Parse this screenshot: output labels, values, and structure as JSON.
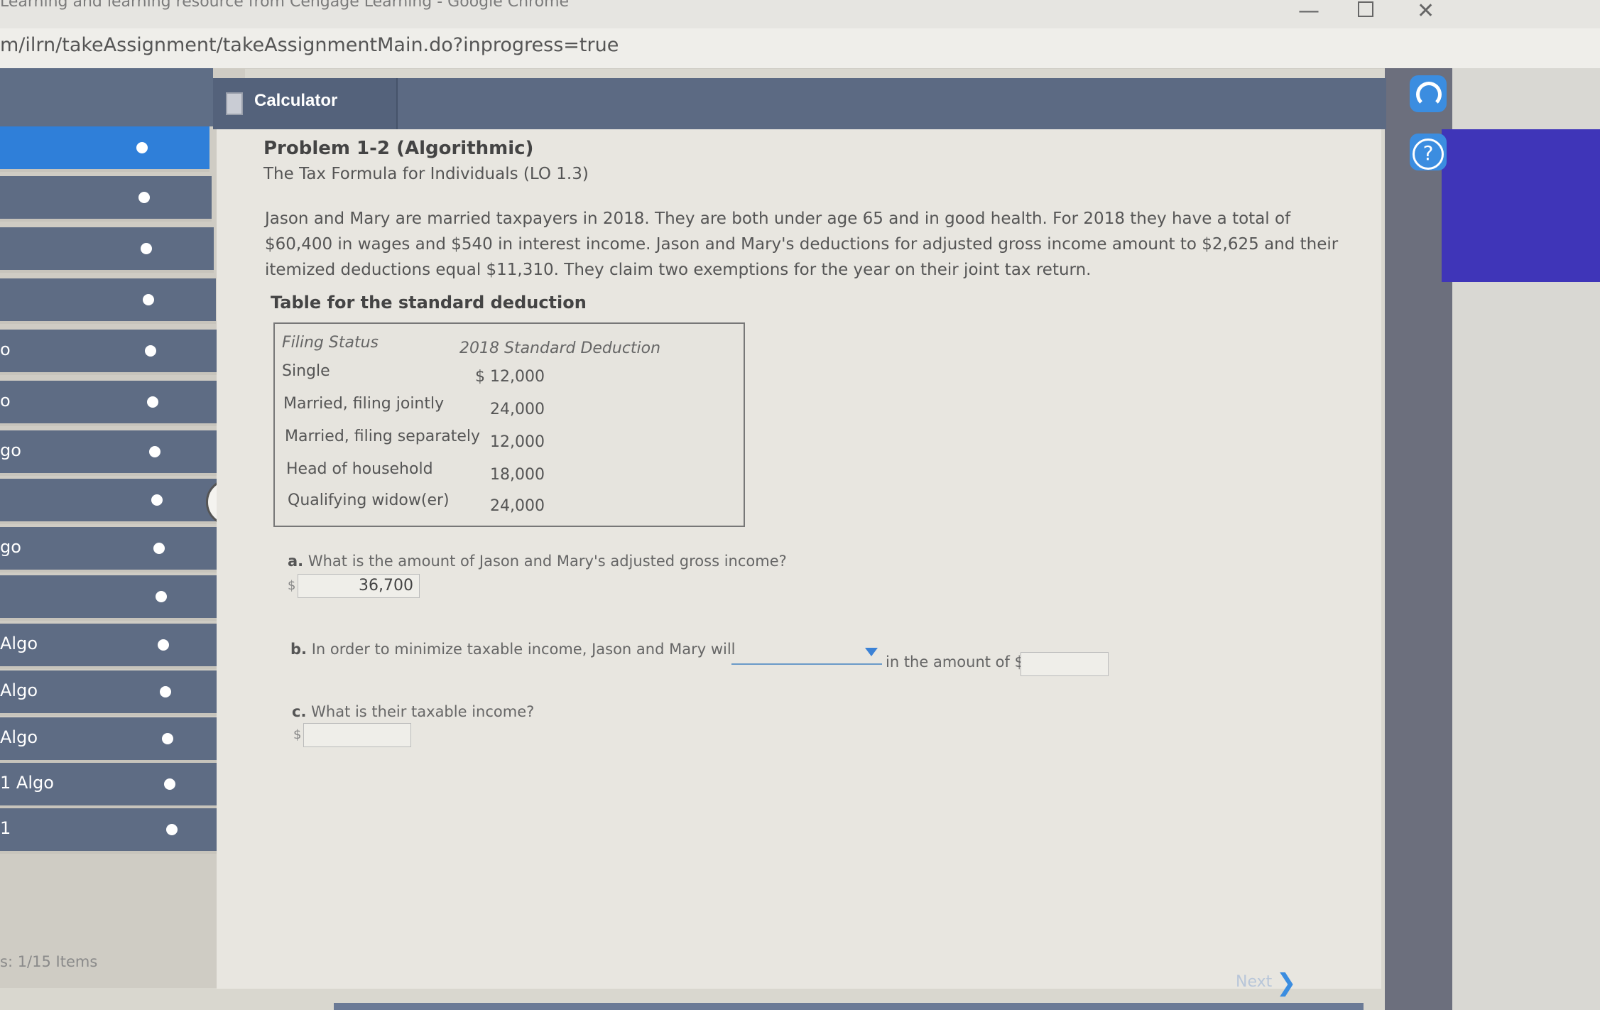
{
  "window": {
    "title": "Learning and learning resource from Cengage Learning - Google Chrome",
    "min_symbol": "—",
    "close_symbol": "✕",
    "url": "m/ilrn/takeAssignment/takeAssignmentMain.do?inprogress=true"
  },
  "toolbar": {
    "calculator_label": "Calculator"
  },
  "sidebar": {
    "items": [
      {
        "label": ""
      },
      {
        "label": ""
      },
      {
        "label": ""
      },
      {
        "label": ""
      },
      {
        "label": "o"
      },
      {
        "label": "o"
      },
      {
        "label": "go"
      },
      {
        "label": ""
      },
      {
        "label": "go"
      },
      {
        "label": ""
      },
      {
        "label": "Algo"
      },
      {
        "label": "Algo"
      },
      {
        "label": "Algo"
      },
      {
        "label": "1 Algo"
      },
      {
        "label": "1"
      }
    ],
    "footer": "s: 1/15 Items",
    "collapse_symbol": "<"
  },
  "problem": {
    "title": "Problem 1-2 (Algorithmic)",
    "subtitle": "The Tax Formula for Individuals (LO 1.3)",
    "text": "Jason and Mary are married taxpayers in 2018. They are both under age 65 and in good health. For 2018 they have a total of $60,400 in wages and $540 in interest income. Jason and Mary's deductions for adjusted gross income amount to $2,625 and their itemized deductions equal $11,310. They claim two exemptions for the year on their joint tax return.",
    "table_caption": "Table for the standard deduction",
    "table": {
      "headers": [
        "Filing Status",
        "2018 Standard Deduction"
      ],
      "rows": [
        {
          "status": "Single",
          "amount": "$ 12,000"
        },
        {
          "status": "Married, filing jointly",
          "amount": "24,000"
        },
        {
          "status": "Married, filing separately",
          "amount": "12,000"
        },
        {
          "status": "Head of household",
          "amount": "18,000"
        },
        {
          "status": "Qualifying widow(er)",
          "amount": "24,000"
        }
      ]
    }
  },
  "questions": {
    "a": {
      "label": "a.",
      "text": "What is the amount of Jason and Mary's adjusted gross income?",
      "currency": "$",
      "value": "36,700"
    },
    "b": {
      "label": "b.",
      "text_before": "In order to minimize taxable income, Jason and Mary will",
      "text_after": "in the amount of",
      "currency": "$",
      "dropdown_value": "",
      "value": ""
    },
    "c": {
      "label": "c.",
      "text": "What is their taxable income?",
      "currency": "$",
      "value": ""
    }
  },
  "nav": {
    "next_label": "Next",
    "next_symbol": "❯"
  },
  "colors": {
    "accent": "#2f7fd9",
    "nav": "#5e6c84",
    "sidebar_panel": "#3f35b8"
  }
}
